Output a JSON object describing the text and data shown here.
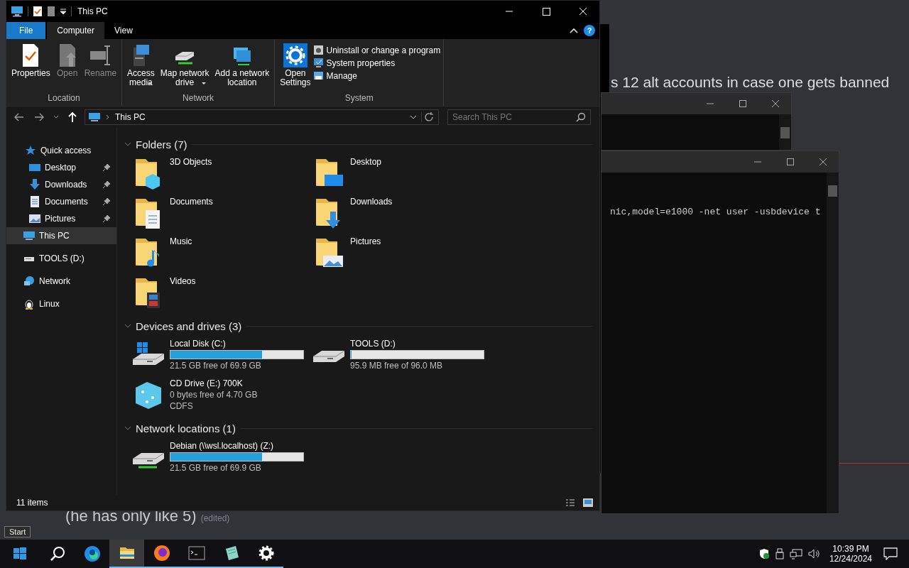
{
  "chat": {
    "messages": [
      {
        "text": "s 12 alt accounts in case one gets banned"
      },
      {
        "text": "(he has only like 5)",
        "edited": "(edited)"
      }
    ]
  },
  "console": {
    "lines": [
      "nic,model=e1000 -net user -usbdevice t"
    ]
  },
  "explorer": {
    "title": "This PC",
    "help_label": "?",
    "tabs": [
      {
        "label": "File",
        "kind": "file",
        "selected": false
      },
      {
        "label": "Computer",
        "kind": "tab",
        "selected": true
      },
      {
        "label": "View",
        "kind": "tab",
        "selected": false
      }
    ],
    "ribbon_groups": [
      {
        "label": "Location",
        "buttons": [
          {
            "label": "Properties",
            "disabled": false,
            "dropdown": false
          },
          {
            "label": "Open",
            "disabled": true,
            "dropdown": false
          },
          {
            "label": "Rename",
            "disabled": true,
            "dropdown": false
          }
        ]
      },
      {
        "label": "Network",
        "buttons": [
          {
            "label": "Access\nmedia",
            "disabled": false,
            "dropdown": true
          },
          {
            "label": "Map network\ndrive",
            "disabled": false,
            "dropdown": true
          },
          {
            "label": "Add a network\nlocation",
            "disabled": false,
            "dropdown": false
          }
        ]
      },
      {
        "label": "System",
        "buttons": [
          {
            "label": "Open\nSettings",
            "disabled": false,
            "dropdown": false
          }
        ],
        "small_buttons": [
          "Uninstall or change a program",
          "System properties",
          "Manage"
        ]
      }
    ],
    "address": {
      "path": "This PC"
    },
    "search": {
      "placeholder": "Search This PC"
    },
    "nav": [
      {
        "label": "Quick access",
        "selected": false,
        "children": [
          {
            "label": "Desktop",
            "pinned": true,
            "selected": false
          },
          {
            "label": "Downloads",
            "pinned": true,
            "selected": false
          },
          {
            "label": "Documents",
            "pinned": true,
            "selected": false
          },
          {
            "label": "Pictures",
            "pinned": true,
            "selected": false
          }
        ]
      },
      {
        "label": "This PC",
        "selected": true
      },
      {
        "label": "TOOLS (D:)",
        "selected": false
      },
      {
        "label": "Network",
        "selected": false
      },
      {
        "label": "Linux",
        "selected": false
      }
    ],
    "sections": [
      {
        "title": "Folders (7)",
        "kind": "folders",
        "items": [
          {
            "name": "3D Objects"
          },
          {
            "name": "Desktop"
          },
          {
            "name": "Documents"
          },
          {
            "name": "Downloads"
          },
          {
            "name": "Music"
          },
          {
            "name": "Pictures"
          },
          {
            "name": "Videos"
          }
        ]
      },
      {
        "title": "Devices and drives (3)",
        "kind": "drives",
        "items": [
          {
            "name": "Local Disk (C:)",
            "level": 0.69,
            "details": [
              "21.5 GB free of 69.9 GB"
            ]
          },
          {
            "name": "TOOLS (D:)",
            "level": 0.002,
            "details": [
              "95.9 MB free of 96.0 MB"
            ]
          },
          {
            "name": "CD Drive (E:) 700K",
            "details": [
              "0 bytes free of 4.70 GB",
              "CDFS"
            ]
          }
        ]
      },
      {
        "title": "Network locations (1)",
        "kind": "drives",
        "items": [
          {
            "name": "Debian (\\\\wsl.localhost) (Z:)",
            "level": 0.69,
            "details": [
              "21.5 GB free of 69.9 GB"
            ]
          }
        ]
      }
    ],
    "status": "11 items"
  },
  "tooltip": "Start",
  "taskbar": {
    "time": "10:39 PM",
    "date": "12/24/2024",
    "apps": [
      {
        "running": false,
        "selected": false
      },
      {
        "running": false,
        "selected": false
      },
      {
        "running": true,
        "selected": true
      },
      {
        "running": true,
        "selected": false
      },
      {
        "running": true,
        "selected": false
      },
      {
        "running": true,
        "selected": false
      },
      {
        "running": true,
        "selected": false
      }
    ]
  }
}
